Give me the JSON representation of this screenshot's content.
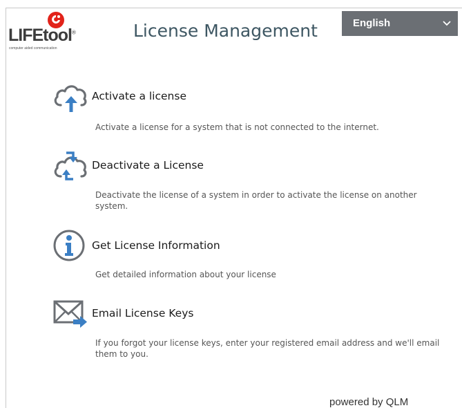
{
  "header": {
    "logo_text": "LIFEtool",
    "logo_tagline": "computer aided communication",
    "title": "License Management",
    "language": "English"
  },
  "items": [
    {
      "title": "Activate a license",
      "description": "Activate a license for a system that is not connected to the internet.",
      "icon": "cloud-upload-icon"
    },
    {
      "title": "Deactivate a License",
      "description": "Deactivate the license of a system in order to activate the license on another system.",
      "icon": "cloud-sync-icon"
    },
    {
      "title": "Get License Information",
      "description": "Get detailed information about your license",
      "icon": "info-icon"
    },
    {
      "title": "Email License Keys",
      "description": "If you forgot your license keys, enter your registered email address and we'll email them to you.",
      "icon": "email-forward-icon"
    }
  ],
  "footer": {
    "powered_by": "powered by QLM"
  },
  "colors": {
    "title": "#3e5763",
    "accent_blue": "#3b7fc4",
    "icon_gray": "#6b6f74",
    "dropdown_bg": "#6b6f74"
  }
}
